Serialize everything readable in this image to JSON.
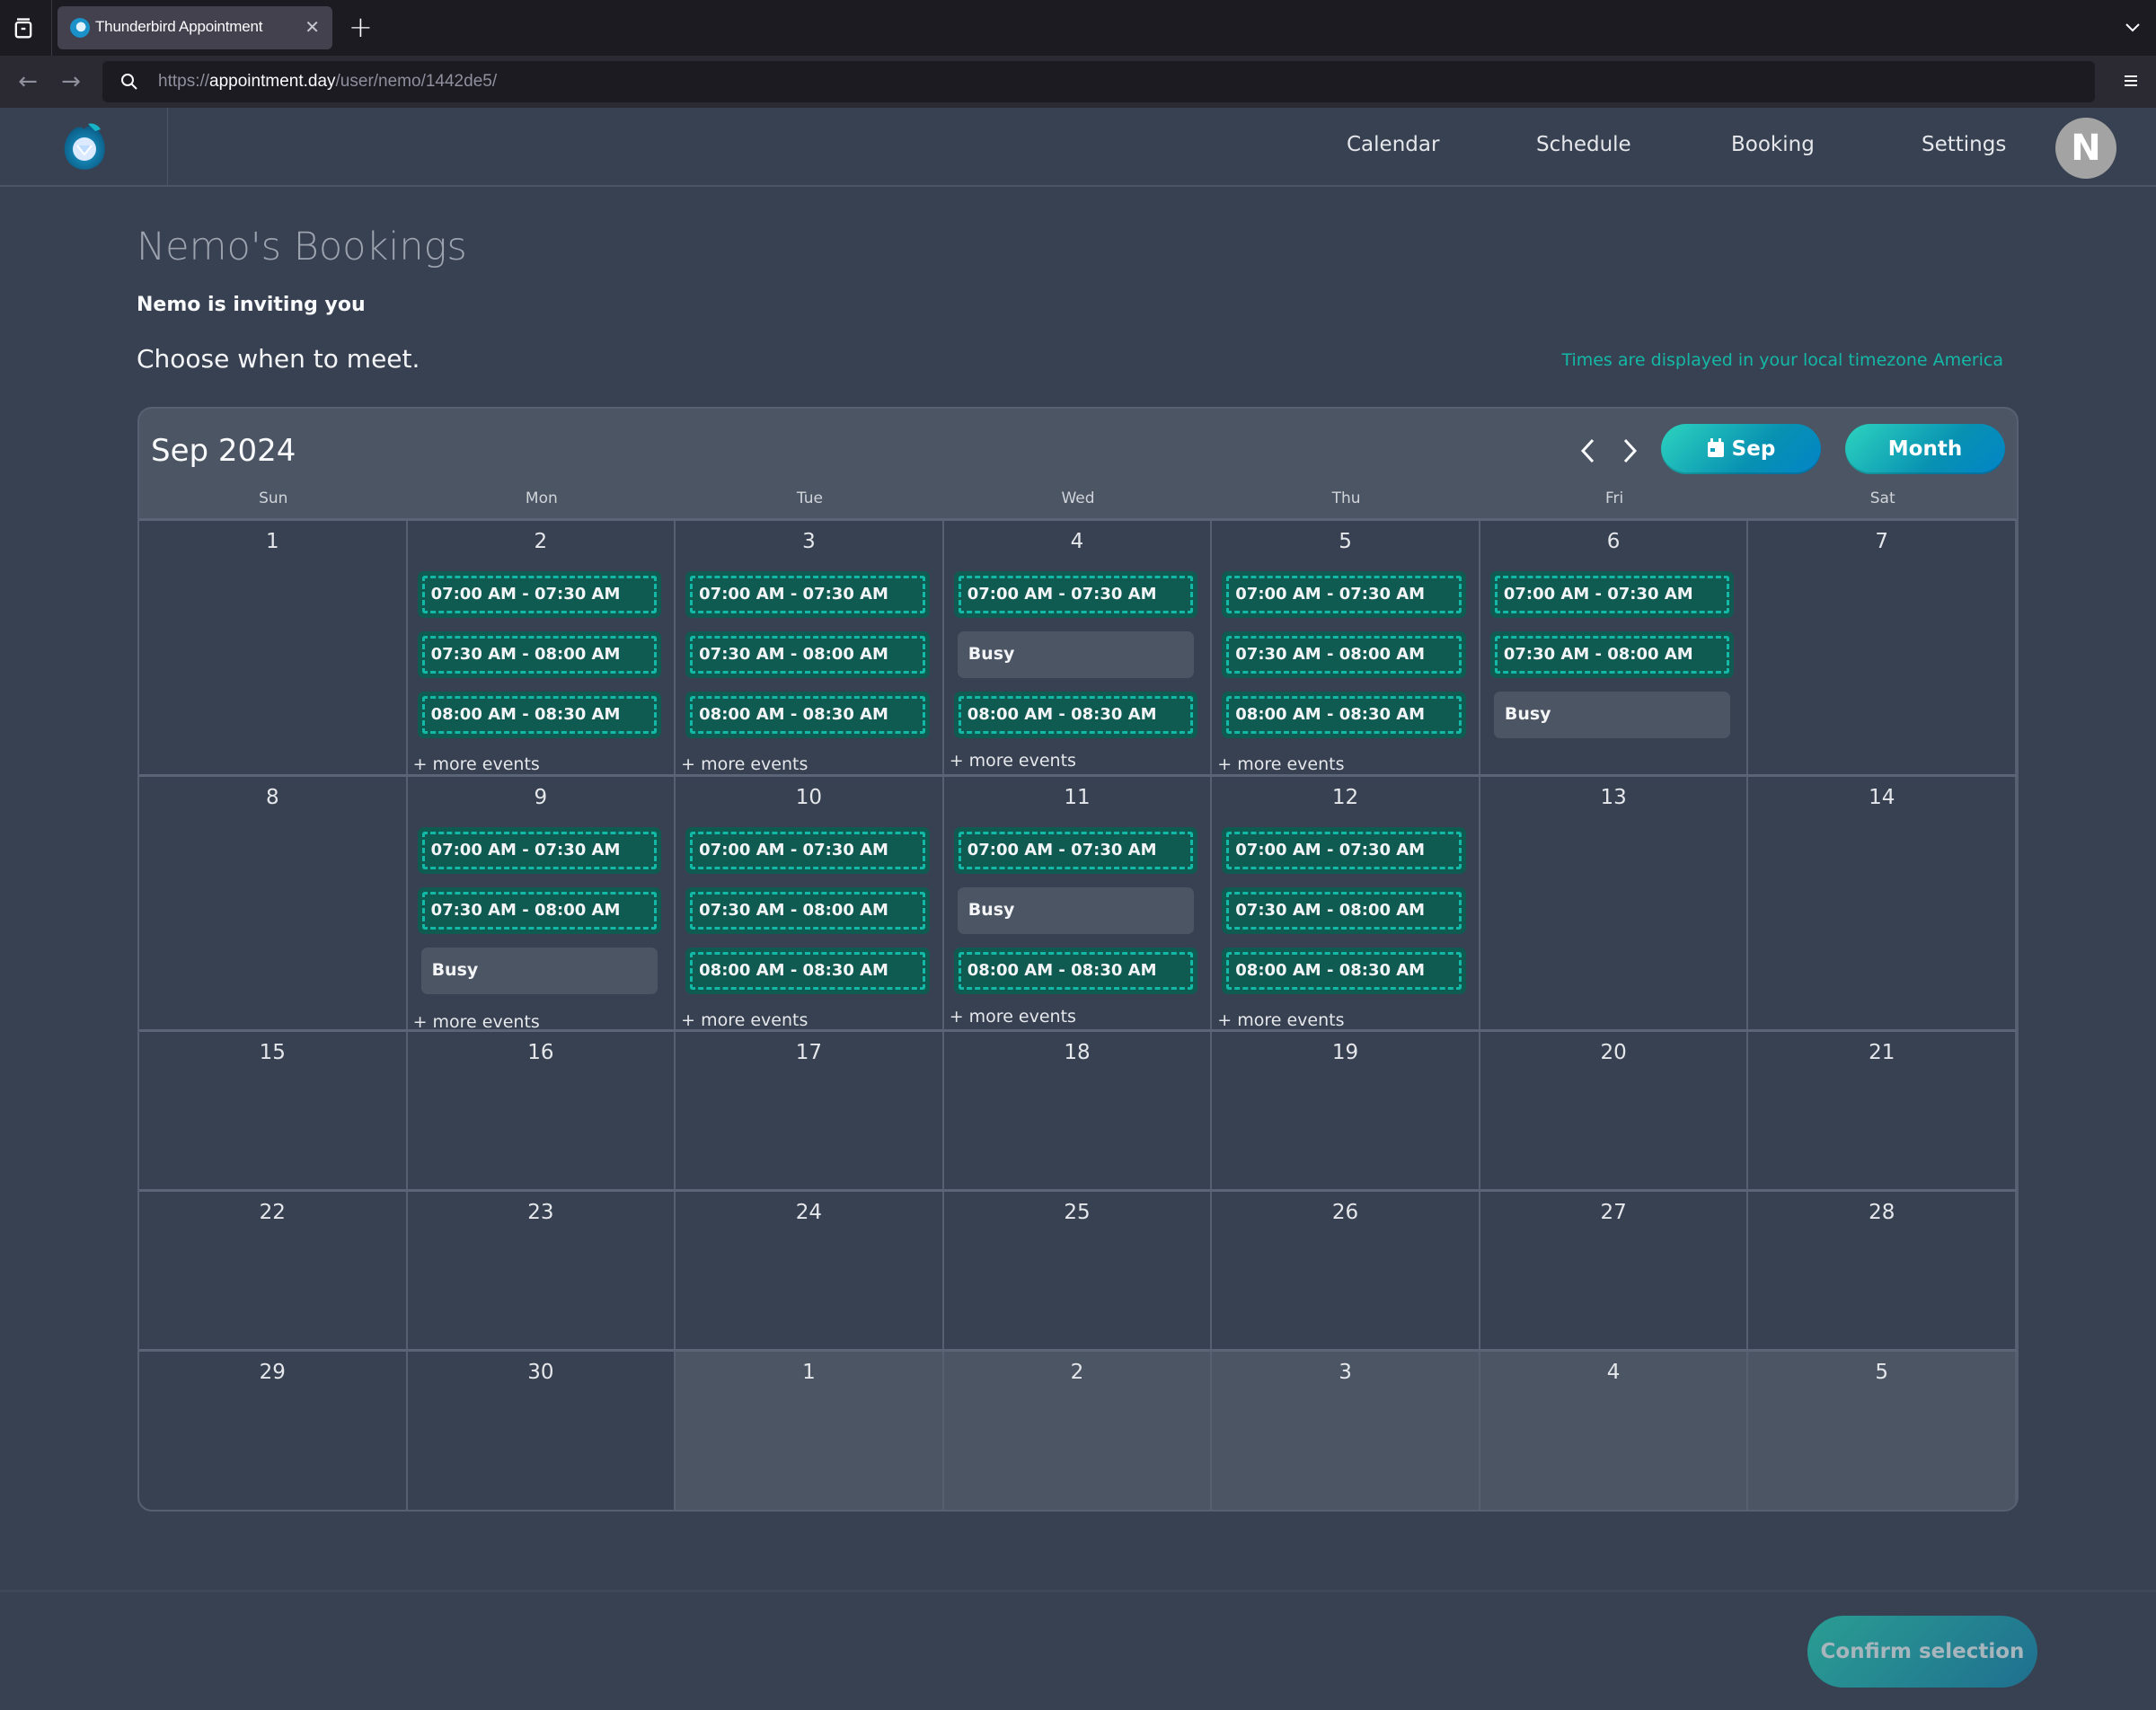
{
  "browser": {
    "tab_title": "Thunderbird Appointment",
    "url_prefix": "https://",
    "url_domain": "appointment.day",
    "url_path": "/user/nemo/1442de5/"
  },
  "header": {
    "nav": [
      {
        "label": "Calendar"
      },
      {
        "label": "Schedule"
      },
      {
        "label": "Booking"
      },
      {
        "label": "Settings"
      }
    ],
    "avatar_initial": "N"
  },
  "page": {
    "title": "Nemo's Bookings",
    "inviting": "Nemo is inviting you",
    "choose": "Choose when to meet.",
    "timezone_note": "Times are displayed in your local timezone America"
  },
  "calendar": {
    "title": "Sep 2024",
    "today_button": "Sep",
    "view_button": "Month",
    "weekdays": [
      "Sun",
      "Mon",
      "Tue",
      "Wed",
      "Thu",
      "Fri",
      "Sat"
    ],
    "more_label": "+ more events",
    "weeks": [
      [
        {
          "day": "1",
          "other": false,
          "events": [],
          "more": false
        },
        {
          "day": "2",
          "other": false,
          "events": [
            {
              "type": "slot",
              "label": "07:00 AM - 07:30 AM"
            },
            {
              "type": "slot",
              "label": "07:30 AM - 08:00 AM"
            },
            {
              "type": "slot",
              "label": "08:00 AM - 08:30 AM"
            }
          ],
          "more": true
        },
        {
          "day": "3",
          "other": false,
          "events": [
            {
              "type": "slot",
              "label": "07:00 AM - 07:30 AM"
            },
            {
              "type": "slot",
              "label": "07:30 AM - 08:00 AM"
            },
            {
              "type": "slot",
              "label": "08:00 AM - 08:30 AM"
            }
          ],
          "more": true
        },
        {
          "day": "4",
          "other": false,
          "events": [
            {
              "type": "slot",
              "label": "07:00 AM - 07:30 AM"
            },
            {
              "type": "busy",
              "label": "Busy"
            },
            {
              "type": "slot",
              "label": "08:00 AM - 08:30 AM"
            }
          ],
          "more": true
        },
        {
          "day": "5",
          "other": false,
          "events": [
            {
              "type": "slot",
              "label": "07:00 AM - 07:30 AM"
            },
            {
              "type": "slot",
              "label": "07:30 AM - 08:00 AM"
            },
            {
              "type": "slot",
              "label": "08:00 AM - 08:30 AM"
            }
          ],
          "more": true
        },
        {
          "day": "6",
          "other": false,
          "events": [
            {
              "type": "slot",
              "label": "07:00 AM - 07:30 AM"
            },
            {
              "type": "slot",
              "label": "07:30 AM - 08:00 AM"
            },
            {
              "type": "busy",
              "label": "Busy"
            }
          ],
          "more": false
        },
        {
          "day": "7",
          "other": false,
          "events": [],
          "more": false
        }
      ],
      [
        {
          "day": "8",
          "other": false,
          "events": [],
          "more": false
        },
        {
          "day": "9",
          "other": false,
          "events": [
            {
              "type": "slot",
              "label": "07:00 AM - 07:30 AM"
            },
            {
              "type": "slot",
              "label": "07:30 AM - 08:00 AM"
            },
            {
              "type": "busy",
              "label": "Busy"
            }
          ],
          "more": true
        },
        {
          "day": "10",
          "other": false,
          "events": [
            {
              "type": "slot",
              "label": "07:00 AM - 07:30 AM"
            },
            {
              "type": "slot",
              "label": "07:30 AM - 08:00 AM"
            },
            {
              "type": "slot",
              "label": "08:00 AM - 08:30 AM"
            }
          ],
          "more": true
        },
        {
          "day": "11",
          "other": false,
          "events": [
            {
              "type": "slot",
              "label": "07:00 AM - 07:30 AM"
            },
            {
              "type": "busy",
              "label": "Busy"
            },
            {
              "type": "slot",
              "label": "08:00 AM - 08:30 AM"
            }
          ],
          "more": true
        },
        {
          "day": "12",
          "other": false,
          "events": [
            {
              "type": "slot",
              "label": "07:00 AM - 07:30 AM"
            },
            {
              "type": "slot",
              "label": "07:30 AM - 08:00 AM"
            },
            {
              "type": "slot",
              "label": "08:00 AM - 08:30 AM"
            }
          ],
          "more": true
        },
        {
          "day": "13",
          "other": false,
          "events": [],
          "more": false
        },
        {
          "day": "14",
          "other": false,
          "events": [],
          "more": false
        }
      ],
      [
        {
          "day": "15",
          "other": false,
          "events": [],
          "more": false
        },
        {
          "day": "16",
          "other": false,
          "events": [],
          "more": false
        },
        {
          "day": "17",
          "other": false,
          "events": [],
          "more": false
        },
        {
          "day": "18",
          "other": false,
          "events": [],
          "more": false
        },
        {
          "day": "19",
          "other": false,
          "events": [],
          "more": false
        },
        {
          "day": "20",
          "other": false,
          "events": [],
          "more": false
        },
        {
          "day": "21",
          "other": false,
          "events": [],
          "more": false
        }
      ],
      [
        {
          "day": "22",
          "other": false,
          "events": [],
          "more": false
        },
        {
          "day": "23",
          "other": false,
          "events": [],
          "more": false
        },
        {
          "day": "24",
          "other": false,
          "events": [],
          "more": false
        },
        {
          "day": "25",
          "other": false,
          "events": [],
          "more": false
        },
        {
          "day": "26",
          "other": false,
          "events": [],
          "more": false
        },
        {
          "day": "27",
          "other": false,
          "events": [],
          "more": false
        },
        {
          "day": "28",
          "other": false,
          "events": [],
          "more": false
        }
      ],
      [
        {
          "day": "29",
          "other": false,
          "events": [],
          "more": false
        },
        {
          "day": "30",
          "other": false,
          "events": [],
          "more": false
        },
        {
          "day": "1",
          "other": true,
          "events": [],
          "more": false
        },
        {
          "day": "2",
          "other": true,
          "events": [],
          "more": false
        },
        {
          "day": "3",
          "other": true,
          "events": [],
          "more": false
        },
        {
          "day": "4",
          "other": true,
          "events": [],
          "more": false
        },
        {
          "day": "5",
          "other": true,
          "events": [],
          "more": false
        }
      ]
    ]
  },
  "footer": {
    "confirm_label": "Confirm selection"
  },
  "colors": {
    "accent": "#14b8a6",
    "slot_bg": "#0f5b52",
    "busy_bg": "#4b5563",
    "page_bg": "#384152"
  }
}
